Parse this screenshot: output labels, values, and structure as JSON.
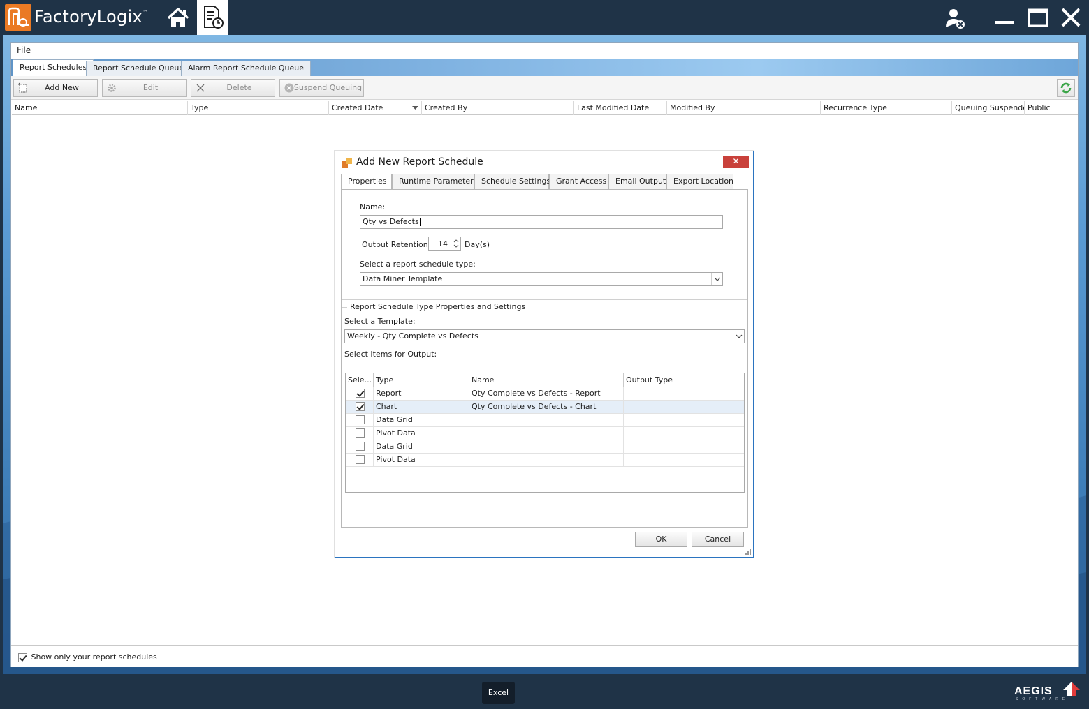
{
  "app": {
    "title": "FactoryLogix",
    "trademark": "™"
  },
  "titlebar": {
    "home_icon": "home-icon",
    "schedule_icon": "report-schedule-icon",
    "user_icon": "user-logout-icon",
    "minimize_icon": "minimize-icon",
    "maximize_icon": "maximize-icon",
    "close_icon": "close-icon"
  },
  "menu": {
    "file_label": "File"
  },
  "tabs": [
    {
      "label": "Report Schedules",
      "active": true
    },
    {
      "label": "Report Schedule Queue",
      "active": false
    },
    {
      "label": "Alarm Report Schedule Queue",
      "active": false
    }
  ],
  "toolbar": {
    "add_new": "Add New",
    "edit": "Edit",
    "delete": "Delete",
    "suspend_queuing": "Suspend Queuing",
    "refresh_icon": "refresh-icon"
  },
  "grid": {
    "columns": [
      "Name",
      "Type",
      "Created Date",
      "Created By",
      "Last Modified Date",
      "Modified By",
      "Recurrence Type",
      "Queuing Suspended",
      "Public"
    ]
  },
  "status": {
    "show_only_label": "Show only your report schedules",
    "show_only_checked": true
  },
  "dialog": {
    "title": "Add New Report Schedule",
    "close_label": "✕",
    "tabs": [
      "Properties",
      "Runtime Parameters",
      "Schedule Settings",
      "Grant Access",
      "Email Output",
      "Export Location"
    ],
    "name_label": "Name:",
    "name_value": "Qty vs Defects",
    "retention_label": "Output Retention:",
    "retention_value": "14",
    "retention_unit": "Day(s)",
    "schedule_type_label": "Select a report schedule type:",
    "schedule_type_value": "Data Miner Template",
    "group_caption": "Report Schedule Type Properties and Settings",
    "template_label": "Select a Template:",
    "template_value": "Weekly - Qty Complete vs Defects",
    "items_label": "Select Items for Output:",
    "items_columns": [
      "Sele...",
      "Type",
      "Name",
      "Output Type"
    ],
    "items": [
      {
        "checked": true,
        "type": "Report",
        "name": "Qty Complete vs Defects - Report",
        "output": ""
      },
      {
        "checked": true,
        "type": "Chart",
        "name": "Qty Complete vs Defects - Chart",
        "output": ""
      },
      {
        "checked": false,
        "type": "Data Grid",
        "name": "",
        "output": ""
      },
      {
        "checked": false,
        "type": "Pivot Data",
        "name": "",
        "output": ""
      },
      {
        "checked": false,
        "type": "Data Grid",
        "name": "",
        "output": ""
      },
      {
        "checked": false,
        "type": "Pivot Data",
        "name": "",
        "output": ""
      }
    ],
    "ok_label": "OK",
    "cancel_label": "Cancel"
  },
  "bottom": {
    "excel_label": "Excel",
    "brand": "AEGIS",
    "brand_sub": "SOFTWARE"
  },
  "colors": {
    "titlebar_bg": "#1f3347",
    "logo_orange": "#ea7a24",
    "dialog_border": "#2b74c0",
    "close_red": "#c9413b",
    "selected_row": "#e5eef8"
  }
}
